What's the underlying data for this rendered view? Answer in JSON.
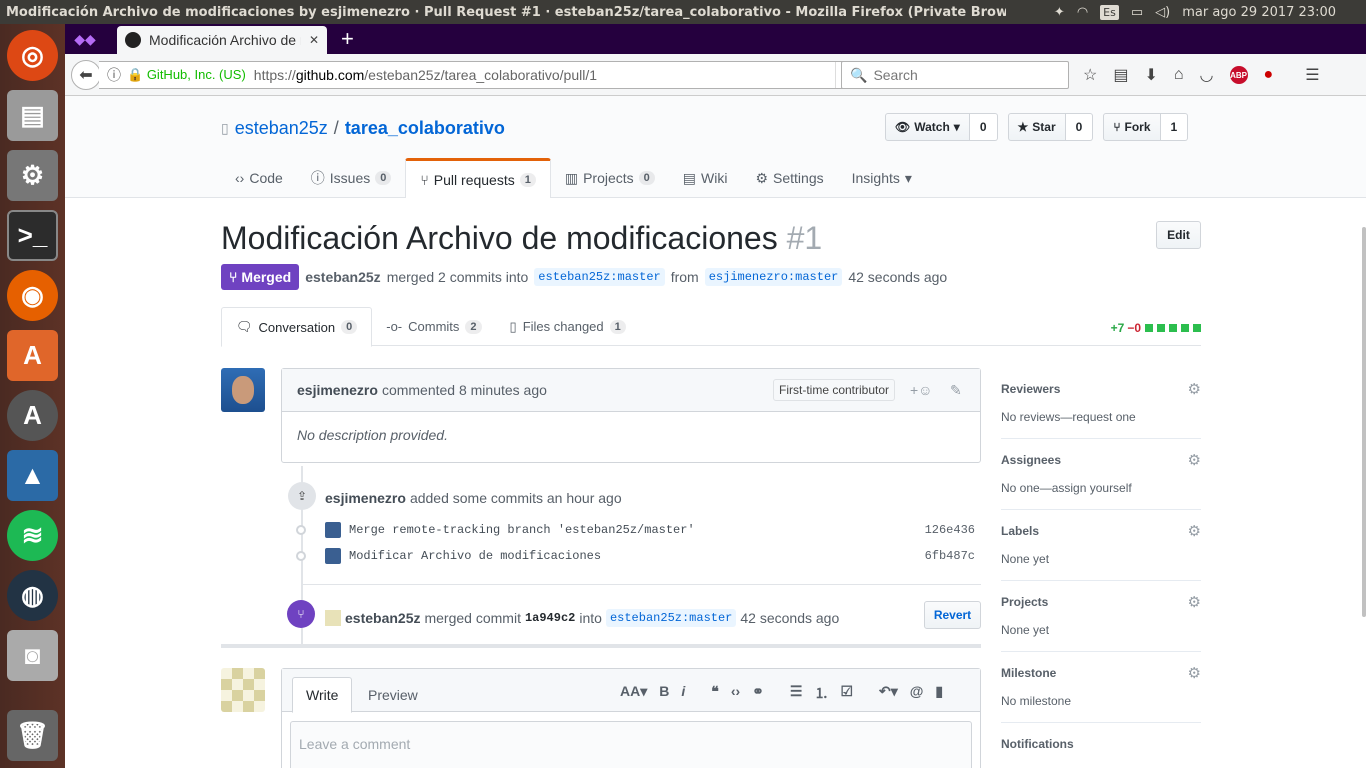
{
  "window": {
    "title": "Modificación Archivo de modificaciones by esjimenezro · Pull Request #1 · esteban25z/tarea_colaborativo - Mozilla Firefox (Private Browsing)"
  },
  "tray": {
    "keyboard": "Es",
    "clock": "mar ago 29 2017 23:00"
  },
  "browser": {
    "tab_title": "Modificación Archivo de modificaciones",
    "identity": "GitHub, Inc. (US)",
    "url_prefix": "https://",
    "url_host": "github.com",
    "url_path": "/esteban25z/tarea_colaborativo/pull/1",
    "search_placeholder": "Search"
  },
  "repo": {
    "owner": "esteban25z",
    "name": "tarea_colaborativo",
    "watch_label": "Watch",
    "watch_count": "0",
    "star_label": "Star",
    "star_count": "0",
    "fork_label": "Fork",
    "fork_count": "1"
  },
  "reponav": {
    "code": "Code",
    "issues": "Issues",
    "issues_count": "0",
    "pulls": "Pull requests",
    "pulls_count": "1",
    "projects": "Projects",
    "projects_count": "0",
    "wiki": "Wiki",
    "settings": "Settings",
    "insights": "Insights"
  },
  "pr": {
    "title": "Modificación Archivo de modificaciones",
    "number": "#1",
    "edit_label": "Edit",
    "state": "Merged",
    "merger": "esteban25z",
    "merged_text": "merged 2 commits into",
    "base_ref": "esteban25z:master",
    "from_text": "from",
    "head_ref": "esjimenezro:master",
    "time": "42 seconds ago"
  },
  "tabs": {
    "conversation": "Conversation",
    "conversation_count": "0",
    "commits": "Commits",
    "commits_count": "2",
    "files": "Files changed",
    "files_count": "1",
    "additions": "+7",
    "deletions": "−0"
  },
  "comment": {
    "author": "esjimenezro",
    "action": "commented 8 minutes ago",
    "badge": "First-time contributor",
    "body": "No description provided."
  },
  "commits_event": {
    "author": "esjimenezro",
    "text": "added some commits an hour ago",
    "items": [
      {
        "message": "Merge remote-tracking branch 'esteban25z/master'",
        "sha": "126e436"
      },
      {
        "message": "Modificar Archivo de modificaciones",
        "sha": "6fb487c"
      }
    ]
  },
  "merge_event": {
    "author": "esteban25z",
    "text": "merged commit",
    "sha": "1a949c2",
    "into": "into",
    "ref": "esteban25z:master",
    "time": "42 seconds ago",
    "revert_label": "Revert"
  },
  "new_comment": {
    "write": "Write",
    "preview": "Preview",
    "placeholder": "Leave a comment"
  },
  "sidebar": {
    "reviewers_h": "Reviewers",
    "reviewers_v": "No reviews—request one",
    "assignees_h": "Assignees",
    "assignees_v": "No one—assign yourself",
    "labels_h": "Labels",
    "labels_v": "None yet",
    "projects_h": "Projects",
    "projects_v": "None yet",
    "milestone_h": "Milestone",
    "milestone_v": "No milestone",
    "notifications_h": "Notifications"
  },
  "colors": {
    "merged": "#6f42c1",
    "link": "#0366d6",
    "tab_accent": "#e36209"
  }
}
